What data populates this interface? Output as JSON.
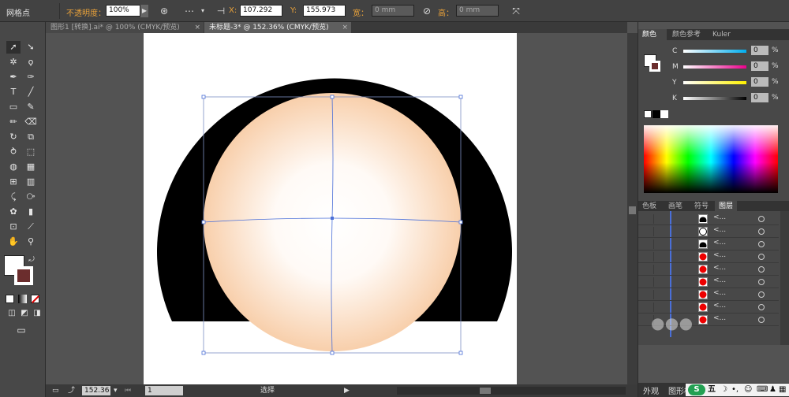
{
  "control_bar": {
    "selection_label": "网格点",
    "opacity_label": "不透明度：",
    "opacity_value": "100%",
    "x_label": "X:",
    "x_value": "107.292",
    "x_unit": "",
    "y_label": "Y:",
    "y_value": "155.973",
    "width_label": "宽：",
    "width_value": "0 mm",
    "height_label": "高：",
    "height_value": "0 mm"
  },
  "tabs": [
    {
      "label": "图形1 [转换].ai* @ 100% (CMYK/预览)",
      "close": "×"
    },
    {
      "label": "未标题-3* @ 152.36% (CMYK/预览)",
      "close": "×"
    }
  ],
  "color_panel": {
    "tabs": [
      "颜色",
      "颜色参考",
      "Kuler"
    ],
    "sliders": [
      {
        "label": "C",
        "value": "0",
        "unit": "%",
        "color": "#00aeef"
      },
      {
        "label": "M",
        "value": "0",
        "unit": "%",
        "color": "#ec008c"
      },
      {
        "label": "Y",
        "value": "0",
        "unit": "%",
        "color": "#fff200"
      },
      {
        "label": "K",
        "value": "0",
        "unit": "%",
        "color": "#000000"
      }
    ]
  },
  "layers_panel": {
    "tabs": [
      "色板",
      "画笔",
      "符号",
      "图层"
    ],
    "rows": [
      {
        "name": "<...",
        "thumb": "black-shape"
      },
      {
        "name": "<...",
        "thumb": "white-circle"
      },
      {
        "name": "<...",
        "thumb": "black-shape"
      },
      {
        "name": "<...",
        "thumb": "red-circle"
      },
      {
        "name": "<...",
        "thumb": "red-circle"
      },
      {
        "name": "<...",
        "thumb": "red-circle"
      },
      {
        "name": "<...",
        "thumb": "red-circle"
      },
      {
        "name": "<...",
        "thumb": "red-circle"
      },
      {
        "name": "<...",
        "thumb": "red-circle"
      }
    ]
  },
  "status_bar": {
    "zoom": "152.36",
    "page": "1",
    "mode": "选择"
  },
  "bottom_dock": {
    "tabs": [
      "外观",
      "图形样"
    ],
    "ime_text": "五"
  },
  "colors": {
    "artboard": "#ffffff",
    "dark_shape": "#000000",
    "gradient_center": "#ffffff",
    "gradient_edge": "#f8cfab",
    "selection": "#4a6fd8"
  }
}
